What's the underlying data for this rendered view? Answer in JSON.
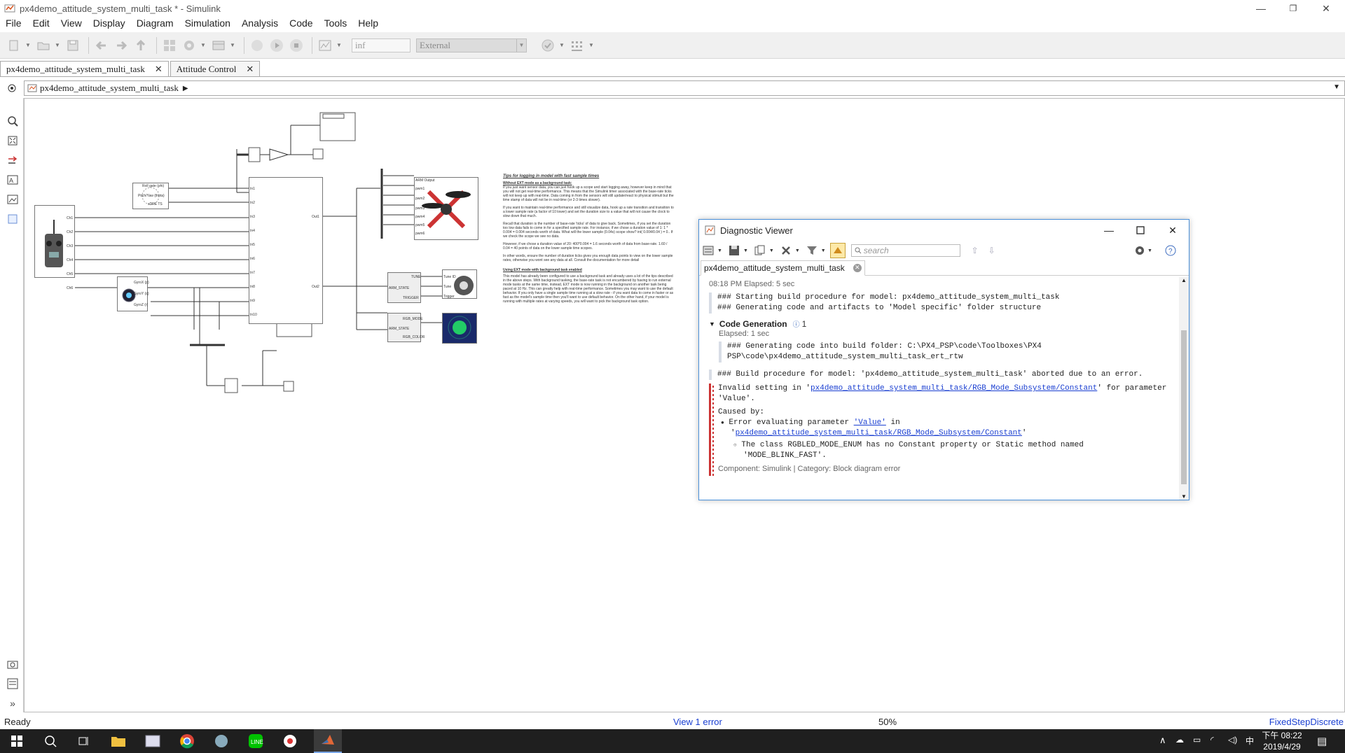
{
  "window": {
    "title": "px4demo_attitude_system_multi_task * - Simulink",
    "minimize": "—",
    "restore": "❐",
    "close": "✕"
  },
  "menu": [
    "File",
    "Edit",
    "View",
    "Display",
    "Diagram",
    "Simulation",
    "Analysis",
    "Code",
    "Tools",
    "Help"
  ],
  "toolbar": {
    "stop_time": "inf",
    "mode": "External"
  },
  "tabs": [
    {
      "label": "px4demo_attitude_system_multi_task",
      "close": "✕"
    },
    {
      "label": "Attitude Control",
      "close": "✕"
    }
  ],
  "breadcrumb": "px4demo_attitude_system_multi_task",
  "model_blocks": {
    "rc_ports": [
      "Ch1",
      "Ch2",
      "Ch3",
      "Ch4",
      "Ch5",
      "Ch6"
    ],
    "mux_in_labels": [
      "Roll gate (phi)",
      "Pitch/Yaw (theta)",
      "xDRE TS"
    ],
    "gyro_ports": [
      "GyroX (p)",
      "GyroY (q)",
      "GyroZ (r)"
    ],
    "ctrl_in_ports": [
      "In1",
      "In2",
      "In3",
      "In4",
      "In5",
      "In6",
      "In7",
      "In8",
      "In9",
      "In10"
    ],
    "ctrl_out_ports": [
      "Out1",
      "Out2"
    ],
    "pwm_labels": [
      "ARM Output",
      "pwm1",
      "pwm2",
      "pwm3",
      "pwm4",
      "pwm5",
      "pwm6"
    ],
    "buzzer_block": [
      "TUNE",
      "ARM_STATE",
      "TRIGGER"
    ],
    "buzzer_ports": [
      "Tune ID",
      "Tune",
      "Trigger"
    ],
    "rgb_block": [
      "RGB_MODE",
      "ARM_STATE",
      "RGB_COLOR"
    ]
  },
  "tips": {
    "title": "Tips for logging in model with fast sample times",
    "h1": "Without EXT mode as a background task:",
    "p1": "If you just want sensor data, you can just hook up a scope and start logging away, however keep in mind that you will not get real-time performance. This means that the Simulink timer associated with the base-rate ticks will not keep up with real-time. Data coming in from the sensors will still update/react to physical stimuli but the time stamp of data will not be in real-time (or 2-3 times slower).",
    "p2": "If you want to maintain real-time performance and still visualize data, hook up a rate transition and transition to a lower sample rate (a factor of 10 lower) and set the duration size to a value that will not cause the clock to slow down that much.",
    "p3": "Recall that duration is the number of base-rate 'ticks' of data to give back. Sometimes, if you set the duration too low data fails to come in for a specified sample rate. For instance, if we chose a duration value of 1: 1 * 0.004 = 0.004 seconds worth of data. What will the lower sample (0.04s) scope show? int( 0.004/0.04 ) = 0.. If we check the scope we see no data.",
    "p4": "However, if we chose a duration value of 20: 400*0.004 = 1.6 seconds worth of data from base-rate. 1.60 / 0.04 = 40 points of data on the lower sample time scopes.",
    "p5": "In other words, ensure the number of duration ticks gives you enough data points to view on the lower sample rates, otherwise you wont see any data at all. Consult the documentation for more detail",
    "h2": "Using EXT mode with background task enabled",
    "p6": "This model has already been configured to use a background task and already uses a lot of the tips described in the above steps. With background tasking, the base-rate task is not encumbered by having to run external mode tasks at the same time, instead, EXT mode is now running in the background on another task being paced at 10 Hz. This can greatly help with real-time performance. Sometimes you may want to use the default behavior. If you only have a single sample time running at a slow rate - if you want data to come in faster or as fast as the model's sample time then you'll want to use default behavior. On the other hand, if your model is running with multiple rates at varying speeds, you will want to pick the background task option."
  },
  "diag": {
    "title": "Diagnostic Viewer",
    "search_placeholder": "search",
    "tab": "px4demo_attitude_system_multi_task",
    "timestamp": "08:18 PM   Elapsed: 5 sec",
    "build_lines": [
      "### Starting build procedure for model: px4demo_attitude_system_multi_task",
      "### Generating code and artifacts to 'Model specific' folder structure"
    ],
    "codegen_label": "Code Generation",
    "codegen_count": "1",
    "codegen_elapsed": "Elapsed: 1 sec",
    "codegen_lines": [
      "### Generating code into build folder: C:\\PX4_PSP\\code\\Toolboxes\\PX4",
      "PSP\\code\\px4demo_attitude_system_multi_task_ert_rtw"
    ],
    "aborted": "### Build procedure for model: 'px4demo_attitude_system_multi_task' aborted due to an error.",
    "err_prefix": "Invalid setting in '",
    "err_link": "px4demo_attitude_system_multi_task/RGB_Mode_Subsystem/Constant",
    "err_suffix": "' for parameter",
    "err_value": "'Value'.",
    "caused_by": "Caused by:",
    "eval_prefix": "Error evaluating parameter ",
    "eval_link": "'Value'",
    "eval_in": " in",
    "eval_path_q1": "'",
    "eval_path_link": "px4demo_attitude_system_multi_task/RGB_Mode_Subsystem/Constant",
    "eval_path_q2": "'",
    "class_line1": "The class RGBLED_MODE_ENUM has no Constant property or Static method named",
    "class_line2": "'MODE_BLINK_FAST'.",
    "component": "Component: Simulink | Category: Block diagram error"
  },
  "status": {
    "ready": "Ready",
    "errors": "View 1 error",
    "zoom": "50%",
    "solver": "FixedStepDiscrete"
  },
  "taskbar": {
    "time_prefix": "下午 08:22",
    "date": "2019/4/29",
    "ime": "中",
    "accent": "#1f1f1f"
  }
}
